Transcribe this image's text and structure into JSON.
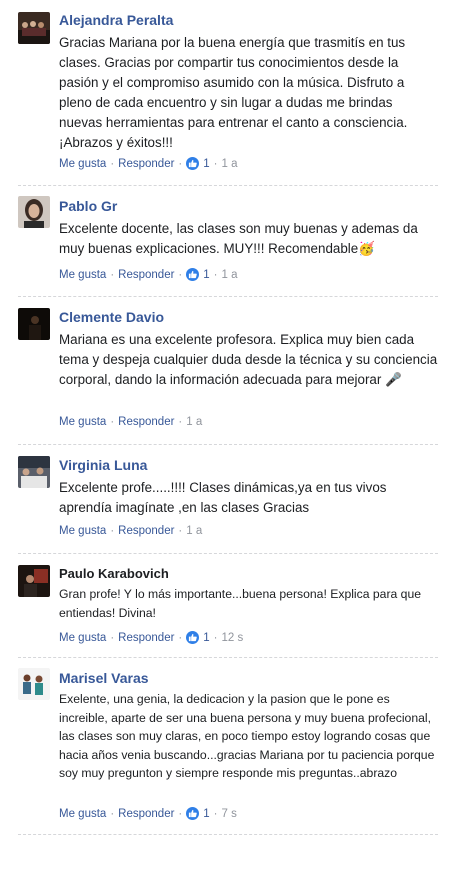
{
  "actions": {
    "like_label": "Me gusta",
    "reply_label": "Responder",
    "separator": "·"
  },
  "comments": [
    {
      "author": "Alejandra Peralta",
      "text": "Gracias Mariana por la buena energía que trasmitís en tus clases. Gracias por compartir tus conocimientos desde la pasión y el compromiso asumido con la música. Disfruto a pleno de cada encuentro y sin lugar a dudas me brindas nuevas herramientas para entrenar el canto a consciencia. ¡Abrazos y éxitos!!!",
      "likes": "1",
      "time": "1 a"
    },
    {
      "author": "Pablo Gr",
      "text": "Excelente docente, las clases son muy buenas y ademas da muy buenas explicaciones. MUY!!! Recomendable🥳",
      "likes": "1",
      "time": "1 a"
    },
    {
      "author": "Clemente Davio",
      "text": "Mariana es una excelente profesora. Explica muy bien cada tema y despeja cualquier duda desde la técnica y su conciencia corporal, dando la información adecuada para mejorar 🎤",
      "time": "1 a"
    },
    {
      "author": "Virginia Luna",
      "text": "Excelente profe.....!!!! Clases dinámicas,ya en tus vivos aprendía imagínate ,en las clases Gracias",
      "time": "1 a"
    },
    {
      "author": "Paulo Karabovich",
      "text": "Gran profe! Y lo más importante...buena persona! Explica para que entiendas! Divina!",
      "likes": "1",
      "time": "12 s"
    },
    {
      "author": "Marisel Varas",
      "text": "Exelente, una genia, la dedicacion y la pasion que le pone es increible, aparte de ser una buena persona y muy buena profecional, las clases son muy claras, en poco tiempo estoy logrando cosas que hacia años venia buscando...gracias Mariana por tu paciencia porque soy muy pregunton y siempre responde mis preguntas..abrazo",
      "likes": "1",
      "time": "7 s"
    }
  ],
  "colors": {
    "link": "#385898",
    "muted": "#90949c",
    "like_badge": "#2f7fe7"
  }
}
